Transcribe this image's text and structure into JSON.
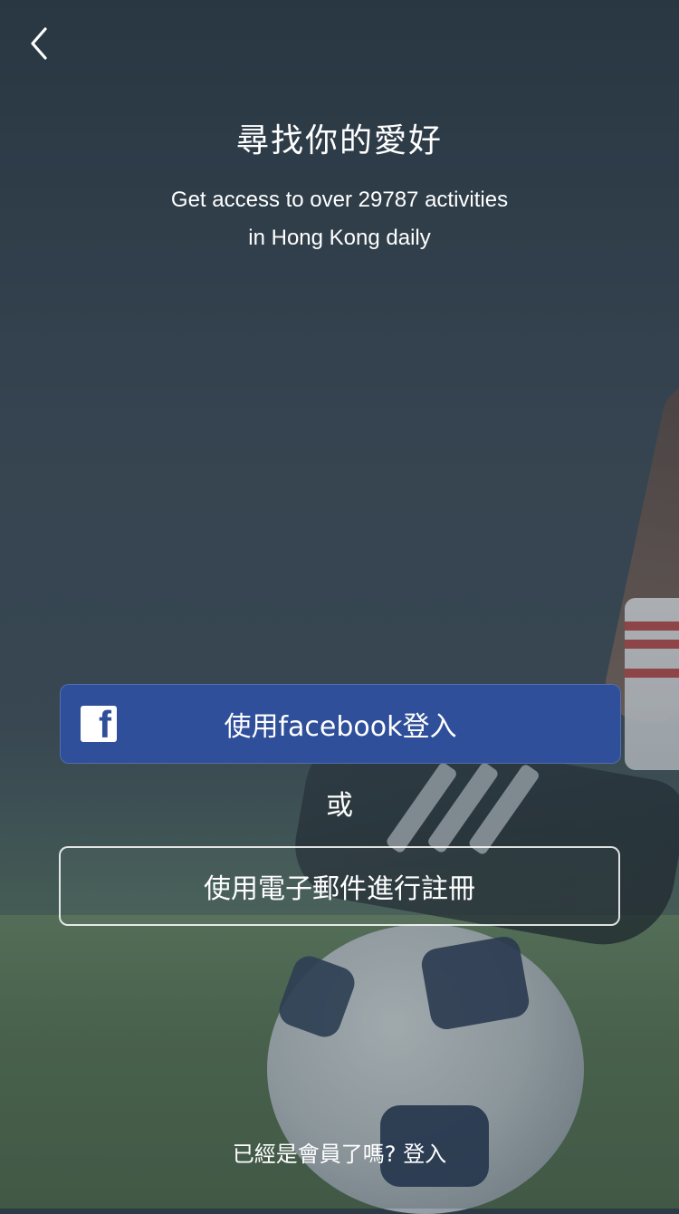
{
  "header": {
    "back_icon": "chevron-left-icon"
  },
  "hero": {
    "title": "尋找你的愛好",
    "subtitle_line1": "Get access to over 29787 activities",
    "subtitle_line2": "in Hong Kong daily"
  },
  "actions": {
    "facebook_label": "使用facebook登入",
    "facebook_icon": "facebook-icon",
    "facebook_icon_glyph": "f",
    "or_text": "或",
    "email_signup_label": "使用電子郵件進行註冊"
  },
  "footer": {
    "member_text": "已經是會員了嗎?",
    "login_link": "登入"
  },
  "colors": {
    "facebook_button": "#070C44",
    "text": "#FFFFFF"
  }
}
